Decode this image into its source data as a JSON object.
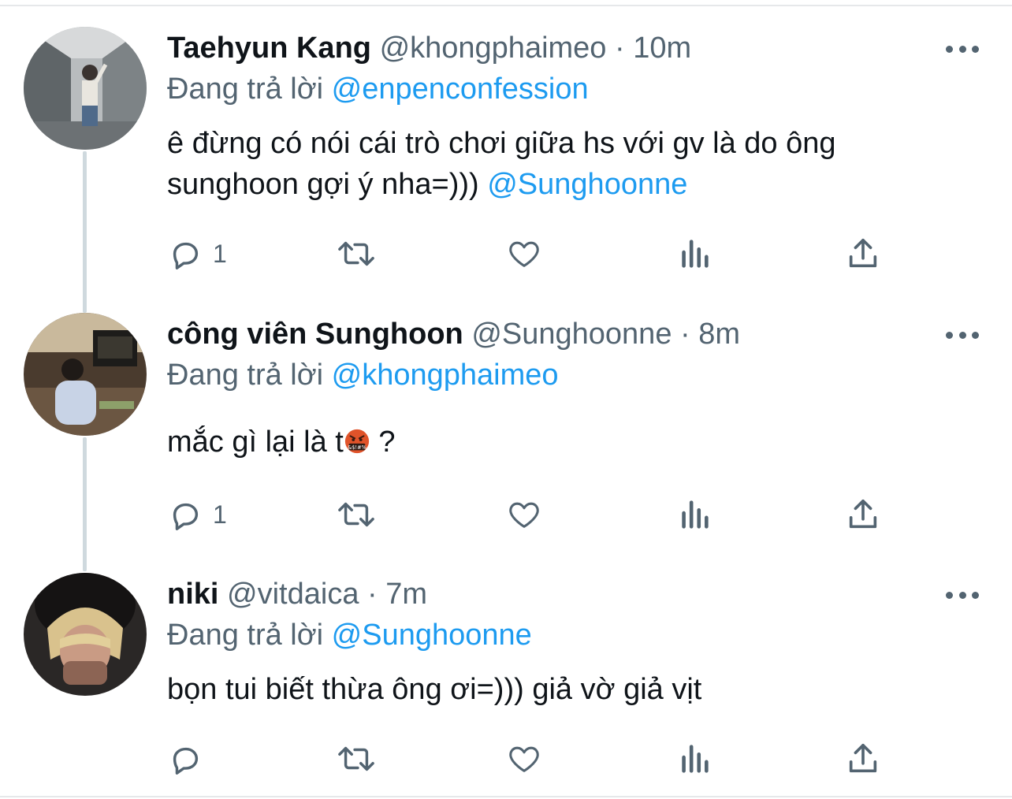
{
  "tweets": [
    {
      "name": "Taehyun Kang",
      "handle": "@khongphaimeo",
      "dot": "·",
      "time": "10m",
      "replying_prefix": "Đang trả lời",
      "replying_to": "@enpenconfession",
      "text": "ê đừng có nói cái trò chơi giữa hs với gv là do ông sunghoon gợi ý nha=)))",
      "mention": "@Sunghoonne",
      "reply_count": "1"
    },
    {
      "name": "công viên Sunghoon",
      "handle": "@Sunghoonne",
      "dot": "·",
      "time": "8m",
      "replying_prefix": "Đang trả lời",
      "replying_to": "@khongphaimeo",
      "text_before": "mắc gì lại là t",
      "emoji": "face-with-symbols-on-mouth",
      "text_after": " ?",
      "reply_count": "1"
    },
    {
      "name": "niki",
      "handle": "@vitdaica",
      "dot": "·",
      "time": "7m",
      "replying_prefix": "Đang trả lời",
      "replying_to": "@Sunghoonne",
      "text": "bọn tui biết thừa ông ơi=))) giả vờ giả vịt",
      "reply_count": ""
    }
  ],
  "icons": {
    "reply": "reply-icon",
    "retweet": "retweet-icon",
    "like": "heart-icon",
    "views": "analytics-icon",
    "share": "share-icon",
    "more": "more-icon"
  },
  "colors": {
    "link": "#1d9bf0",
    "secondary": "#536471",
    "text": "#0f1419",
    "thread_line": "#cfd9de"
  }
}
